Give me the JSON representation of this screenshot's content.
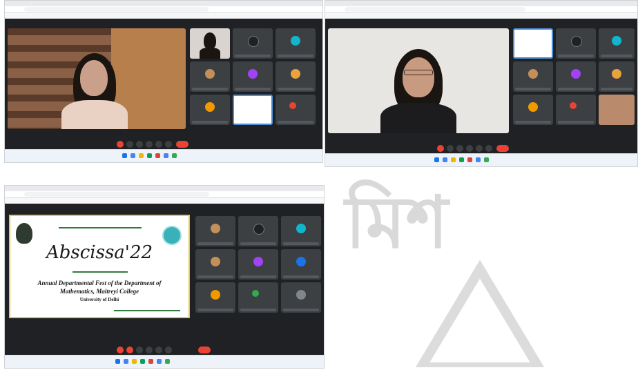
{
  "colors": {
    "meet_bg": "#202124",
    "tile_bg": "#3c4043",
    "end_call": "#ea4335",
    "slide_border": "#e4c84a",
    "accent_teal": "#3ab0b8",
    "taskbar": "#eef3fa"
  },
  "panels": [
    {
      "id": "top-left",
      "title": "",
      "tile_avatar_letters": [
        "",
        "N",
        "",
        "",
        "D",
        "",
        "",
        "",
        ""
      ]
    },
    {
      "id": "top-right",
      "title": "",
      "tile_avatar_letters": [
        "",
        "",
        "N",
        "",
        "",
        "D",
        "",
        "",
        ""
      ]
    },
    {
      "id": "bottom-left",
      "title": "",
      "tile_avatar_letters": [
        "",
        "",
        "N",
        "",
        "B",
        "M",
        "M",
        "",
        "A"
      ]
    }
  ],
  "slide": {
    "title": "Abscissa'22",
    "line1": "Annual Departmental Fest of the Department of",
    "line2": "Mathematics, Maitreyi College",
    "line3": "University of Delhi"
  },
  "watermark": {
    "text": "মিশ"
  }
}
